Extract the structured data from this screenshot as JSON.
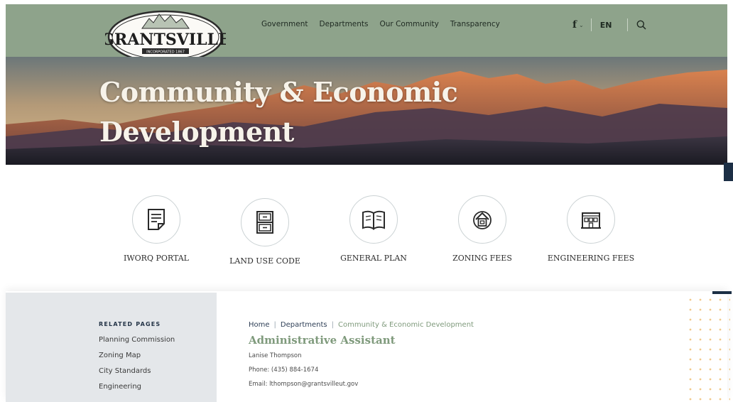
{
  "header": {
    "logo": {
      "name": "GRANTSVILLE",
      "tagline": "INCORPORATED 1867"
    },
    "nav": [
      "Government",
      "Departments",
      "Our Community",
      "Transparency"
    ],
    "facebook_glyph": "f",
    "language": "EN"
  },
  "hero": {
    "title_line1": "Community & Economic",
    "title_line2": "Development"
  },
  "quick_links": [
    {
      "label": "IWORQ PORTAL",
      "icon": "document-icon"
    },
    {
      "label": "LAND USE CODE",
      "icon": "file-cabinet-icon"
    },
    {
      "label": "GENERAL PLAN",
      "icon": "open-book-icon"
    },
    {
      "label": "ZONING FEES",
      "icon": "home-zoning-icon"
    },
    {
      "label": "ENGINEERING FEES",
      "icon": "building-icon"
    }
  ],
  "sidebar": {
    "heading": "RELATED PAGES",
    "items": [
      "Planning Commission",
      "Zoning Map",
      "City Standards",
      "Engineering"
    ]
  },
  "content": {
    "breadcrumb": [
      "Home",
      "Departments",
      "Community & Economic Development"
    ],
    "title": "Administrative Assistant",
    "name": "Lanise Thompson",
    "phone": "Phone: (435) 884-1674",
    "email": "Email: lthompson@grantsvilleut.gov"
  },
  "colors": {
    "header_bg": "#8ea38b",
    "accent_green": "#7f9a7c",
    "navy": "#1c2f45",
    "sidebar_bg": "#e4e7ea",
    "dots": "#f2c98a"
  }
}
